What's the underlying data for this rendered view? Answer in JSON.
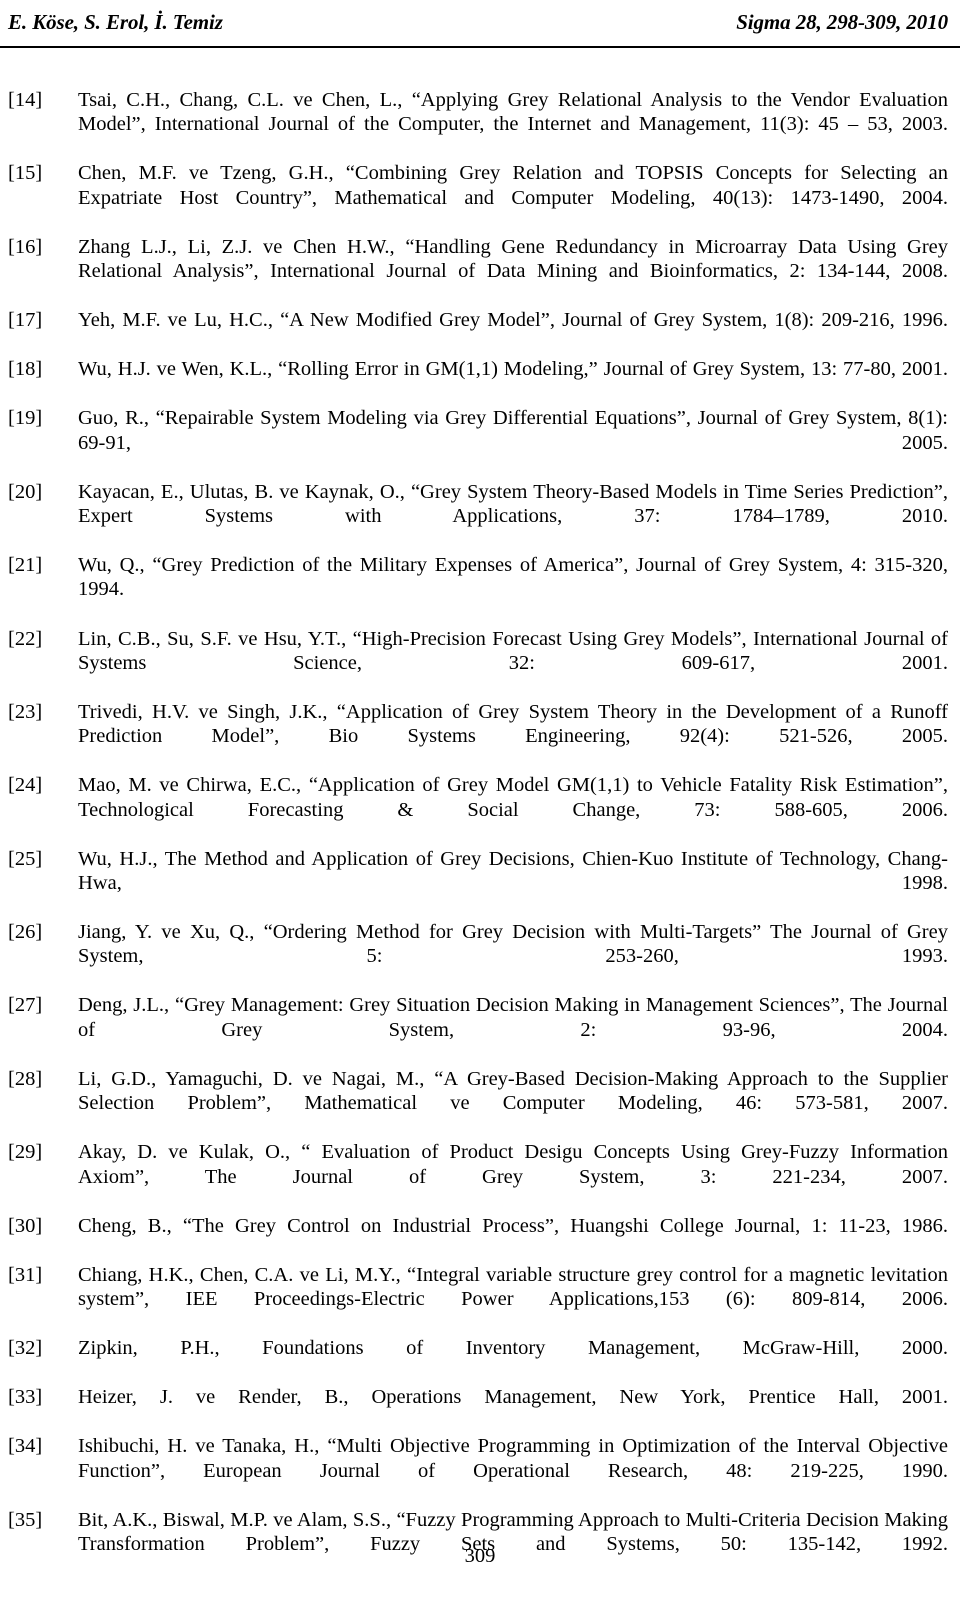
{
  "header": {
    "authors": "E. Köse, S. Erol, İ. Temiz",
    "journal": "Sigma 28, 298-309, 2010"
  },
  "references": [
    {
      "number": "[14]",
      "text": "Tsai, C.H., Chang, C.L. ve Chen, L., “Applying Grey Relational Analysis to the Vendor Evaluation Model”, International Journal of the Computer, the Internet and Management, 11(3): 45 – 53, 2003."
    },
    {
      "number": "[15]",
      "text": "Chen, M.F. ve Tzeng, G.H., “Combining Grey Relation and TOPSIS Concepts for Selecting an Expatriate Host Country”, Mathematical and Computer Modeling, 40(13): 1473-1490, 2004."
    },
    {
      "number": "[16]",
      "text": "Zhang L.J., Li, Z.J. ve Chen H.W., “Handling Gene Redundancy in Microarray Data Using Grey Relational Analysis”, International Journal of Data Mining and Bioinformatics, 2: 134-144, 2008."
    },
    {
      "number": "[17]",
      "text": "Yeh, M.F. ve Lu, H.C., “A New Modified Grey Model”, Journal of Grey System, 1(8): 209-216, 1996."
    },
    {
      "number": "[18]",
      "text": "Wu, H.J. ve Wen, K.L., “Rolling Error in GM(1,1) Modeling,” Journal of Grey System, 13: 77-80, 2001."
    },
    {
      "number": "[19]",
      "text": "Guo, R., “Repairable System Modeling via Grey Differential Equations”, Journal of Grey System, 8(1): 69-91, 2005."
    },
    {
      "number": "[20]",
      "text": "Kayacan, E., Ulutas, B. ve Kaynak, O., “Grey System Theory-Based Models in Time Series Prediction”, Expert Systems with Applications, 37: 1784–1789, 2010."
    },
    {
      "number": "[21]",
      "text": "Wu, Q., “Grey Prediction of the Military Expenses of America”, Journal of Grey System, 4: 315-320, 1994."
    },
    {
      "number": "[22]",
      "text": "Lin, C.B., Su, S.F. ve Hsu, Y.T., “High-Precision Forecast Using Grey Models”, International Journal of Systems Science, 32: 609-617, 2001."
    },
    {
      "number": "[23]",
      "text": "Trivedi, H.V. ve Singh, J.K., “Application of Grey System Theory in the Development of a Runoff Prediction Model”, Bio Systems Engineering, 92(4): 521-526, 2005."
    },
    {
      "number": "[24]",
      "text": "Mao, M. ve Chirwa, E.C., “Application of Grey Model GM(1,1) to Vehicle Fatality Risk Estimation”, Technological Forecasting & Social Change, 73: 588-605, 2006."
    },
    {
      "number": "[25]",
      "text": "Wu, H.J., The Method and Application of Grey Decisions, Chien-Kuo Institute of Technology, Chang-Hwa, 1998."
    },
    {
      "number": "[26]",
      "text": "Jiang, Y. ve Xu, Q., “Ordering Method for Grey Decision with Multi-Targets” The Journal of Grey System, 5: 253-260, 1993."
    },
    {
      "number": "[27]",
      "text": "Deng, J.L., “Grey Management: Grey Situation Decision Making in Management Sciences”, The Journal of Grey System, 2: 93-96, 2004."
    },
    {
      "number": "[28]",
      "text": "Li, G.D., Yamaguchi, D. ve Nagai, M., “A Grey-Based Decision-Making Approach to the Supplier Selection Problem”, Mathematical ve Computer Modeling, 46: 573-581, 2007."
    },
    {
      "number": "[29]",
      "text": "Akay, D. ve Kulak, O., “ Evaluation of Product Desigu Concepts Using Grey-Fuzzy Information Axiom”, The Journal of Grey System, 3: 221-234, 2007."
    },
    {
      "number": "[30]",
      "text": "Cheng, B., “The Grey Control on Industrial Process”, Huangshi College Journal, 1: 11-23, 1986."
    },
    {
      "number": "[31]",
      "text": "Chiang, H.K., Chen, C.A. ve Li, M.Y., “Integral variable structure grey control for a magnetic levitation system”, IEE Proceedings-Electric Power Applications,153 (6): 809-814, 2006."
    },
    {
      "number": "[32]",
      "text": "Zipkin, P.H., Foundations of Inventory Management, McGraw-Hill, 2000."
    },
    {
      "number": "[33]",
      "text": "Heizer, J. ve Render, B., Operations Management, New York, Prentice Hall, 2001."
    },
    {
      "number": "[34]",
      "text": "Ishibuchi, H. ve Tanaka, H., “Multi Objective Programming in Optimization of the Interval Objective Function”, European Journal of Operational Research, 48: 219-225, 1990."
    },
    {
      "number": "[35]",
      "text": "Bit, A.K., Biswal, M.P. ve Alam, S.S., “Fuzzy Programming Approach to Multi-Criteria Decision Making Transformation Problem”, Fuzzy Sets and Systems, 50: 135-142, 1992."
    }
  ],
  "footer": {
    "page_number": "309"
  }
}
